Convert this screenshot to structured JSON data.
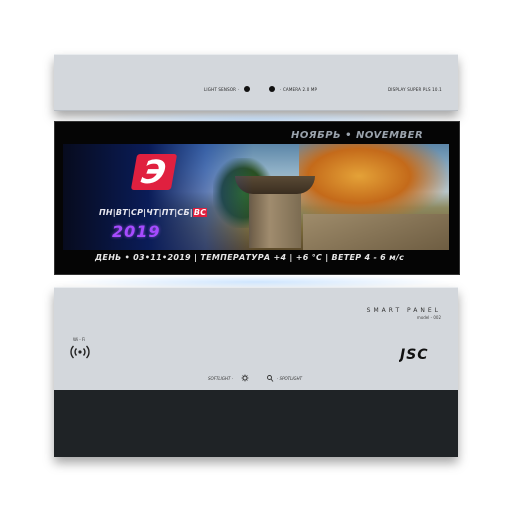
{
  "top_bezel": {
    "light_sensor_label": "LIGHT SENSOR ·",
    "camera_label": "· CAMERA 2.0 MP",
    "display_label": "DISPLAY SUPER PLS 10.1"
  },
  "screen": {
    "month_header": "НОЯБРЬ • NOVEMBER",
    "logo_letter": "Э",
    "weekdays": [
      "ПН",
      "ВТ",
      "СР",
      "ЧТ",
      "ПТ",
      "СБ"
    ],
    "weekday_highlight": "ВС",
    "year": "2019",
    "ticker": "ДЕНЬ • 03•11•2019 | ТЕМПЕРАТУРА +4 | +6 °C | ВЕТЕР 4 - 6 м/с"
  },
  "bottom_panel": {
    "title": "SMART PANEL",
    "model": "model - 002",
    "wifi_label": "Wi - Fi",
    "brand": "JSC",
    "softlight_label": "SOFTLIGHT ·",
    "spotlight_label": "· SPOTLIGHT"
  },
  "colors": {
    "panel_gray": "#d3d7dc",
    "panel_dark": "#1f2326",
    "accent_red": "#e0203f",
    "year_purple": "#a64bff"
  },
  "icons": [
    "wifi-icon",
    "softlight-icon",
    "spotlight-icon",
    "jsc-logo"
  ]
}
